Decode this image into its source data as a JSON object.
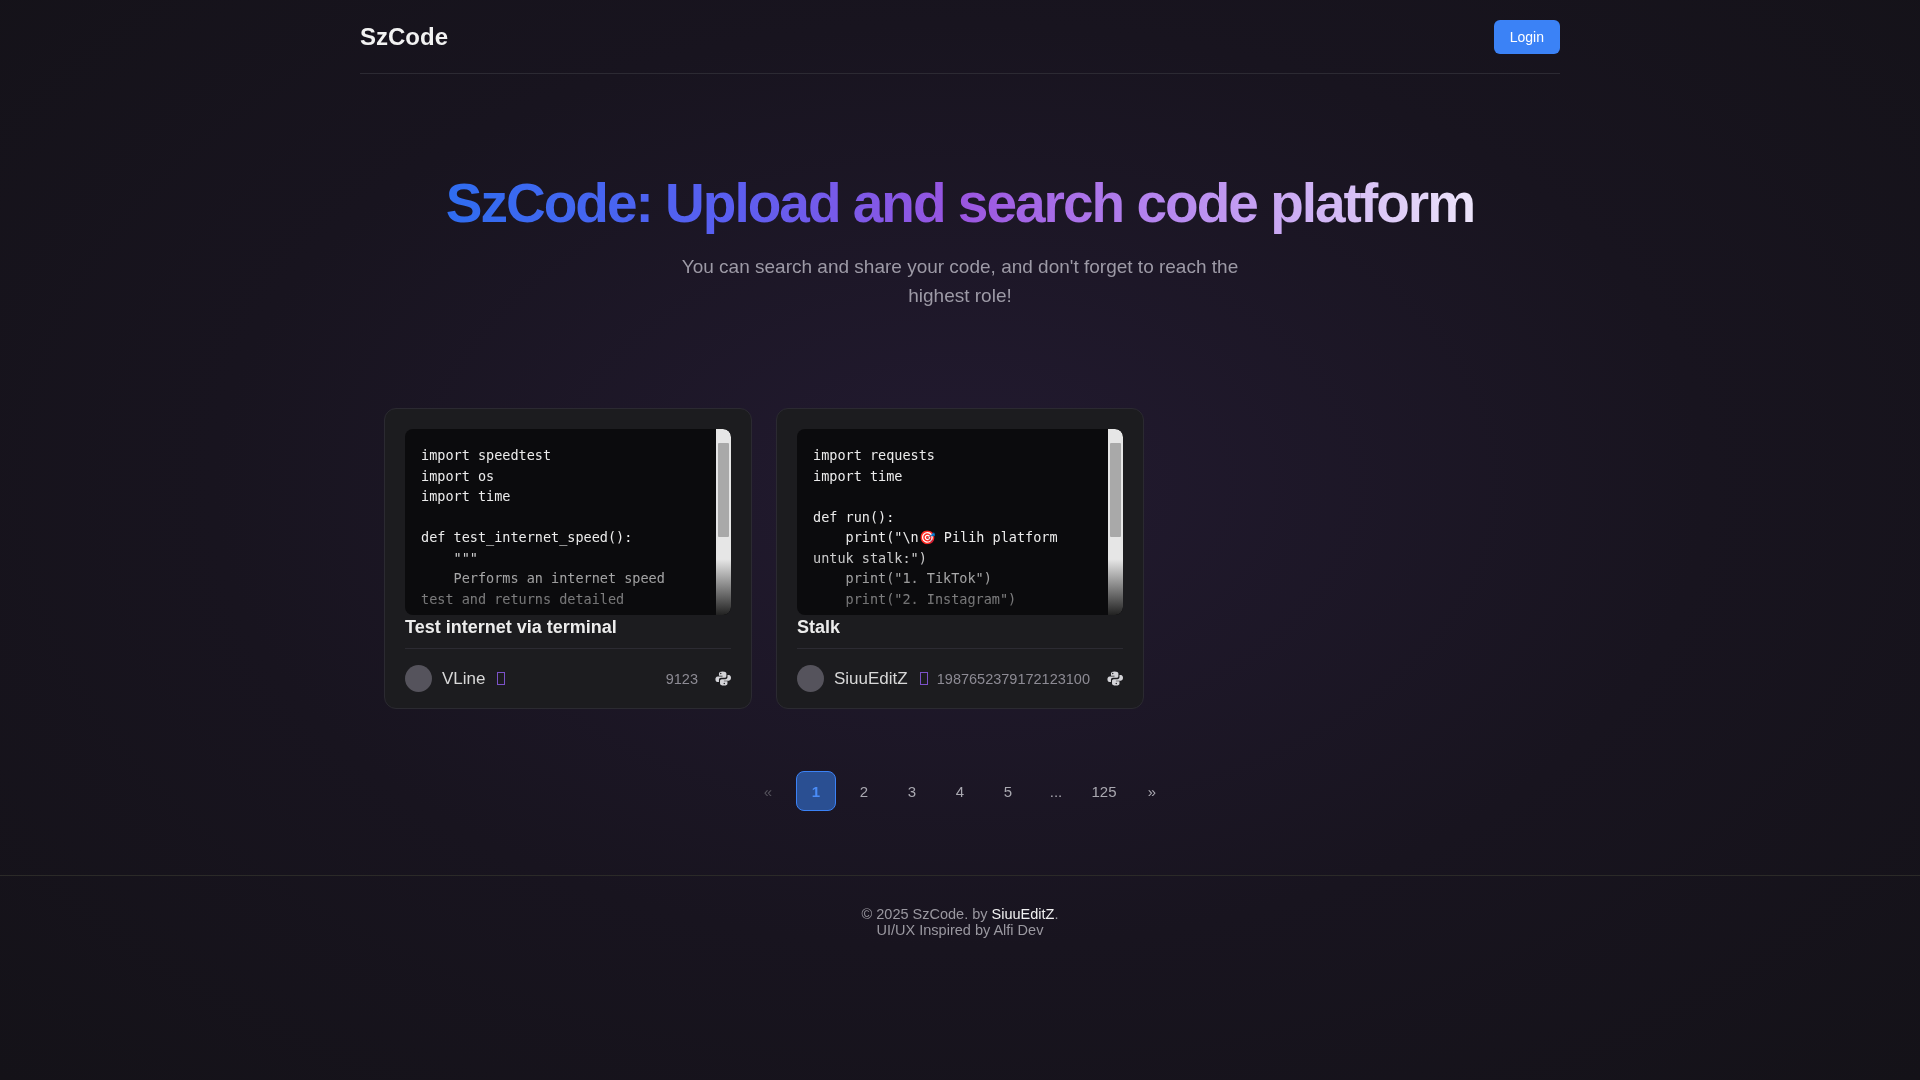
{
  "header": {
    "logo": "SzCode",
    "login_button": "Login"
  },
  "hero": {
    "title": "SzCode: Upload and search code platform",
    "subtitle": "You can search and share your code, and don't forget to reach the highest role!"
  },
  "snippets": [
    {
      "code": "import speedtest\nimport os\nimport time\n\ndef test_internet_speed():\n    \"\"\"\n    Performs an internet speed\ntest and returns detailed",
      "title": "Test internet via terminal",
      "author": "VLine",
      "verified": true,
      "count": "9123",
      "kind": "python"
    },
    {
      "code": "import requests\nimport time\n\ndef run():\n    print(\"\\n🎯 Pilih platform\nuntuk stalk:\")\n    print(\"1. TikTok\")\n    print(\"2. Instagram\")",
      "title": "Stalk",
      "author": "SiuuEditZ",
      "verified": true,
      "count": "1987652379172123100",
      "kind": "python"
    }
  ],
  "pagination": [
    {
      "label": "«",
      "selected": false,
      "disabled": true
    },
    {
      "label": "1",
      "selected": true,
      "disabled": false
    },
    {
      "label": "2",
      "selected": false,
      "disabled": false
    },
    {
      "label": "3",
      "selected": false,
      "disabled": false
    },
    {
      "label": "4",
      "selected": false,
      "disabled": false
    },
    {
      "label": "5",
      "selected": false,
      "disabled": false
    },
    {
      "label": "...",
      "selected": false,
      "disabled": false
    },
    {
      "label": "125",
      "selected": false,
      "disabled": false
    },
    {
      "label": "»",
      "selected": false,
      "disabled": false
    }
  ],
  "footer": {
    "copyright": "© 2025 SzCode. by",
    "author_link": "SiuuEditZ",
    "end": ".",
    "credit": "UI/UX Inspired by Alfi Dev"
  }
}
